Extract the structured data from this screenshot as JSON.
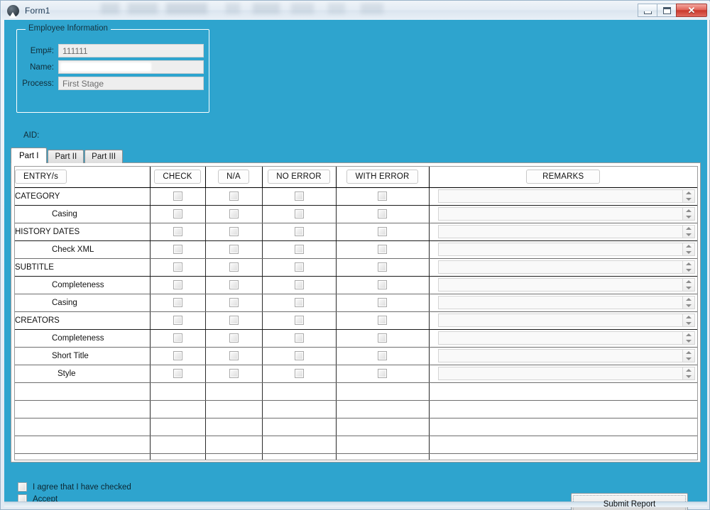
{
  "window": {
    "title": "Form1",
    "icon": "app-logo-icon",
    "buttons": {
      "minimize": "minimize-button",
      "maximize": "maximize-button",
      "close_label": "✕"
    }
  },
  "employee_group": {
    "legend": "Employee Information",
    "fields": [
      {
        "label": "Emp#:",
        "value": "111111",
        "redacted": false
      },
      {
        "label": "Name:",
        "value": "",
        "redacted": true
      },
      {
        "label": "Process:",
        "value": "First Stage",
        "redacted": false
      }
    ]
  },
  "aid": {
    "label": "AID:",
    "value": ""
  },
  "tabs": [
    {
      "label": "Part I",
      "active": true
    },
    {
      "label": "Part II",
      "active": false
    },
    {
      "label": "Part III",
      "active": false
    }
  ],
  "grid": {
    "headers": {
      "entry": "ENTRY/s",
      "check": "CHECK",
      "na": "N/A",
      "no_error": "NO ERROR",
      "with_error": "WITH ERROR",
      "remarks": "REMARKS"
    },
    "rows": [
      {
        "entry": "CATEGORY",
        "indent": 0,
        "major": true,
        "checkboxes": true,
        "remarks": "",
        "has_remarks": true
      },
      {
        "entry": "Casing",
        "indent": 1,
        "major": false,
        "checkboxes": true,
        "remarks": "",
        "has_remarks": true
      },
      {
        "entry": "HISTORY DATES",
        "indent": 0,
        "major": true,
        "checkboxes": true,
        "remarks": "",
        "has_remarks": true
      },
      {
        "entry": "Check XML",
        "indent": 1,
        "major": false,
        "checkboxes": true,
        "remarks": "",
        "has_remarks": true
      },
      {
        "entry": "SUBTITLE",
        "indent": 0,
        "major": true,
        "checkboxes": true,
        "remarks": "",
        "has_remarks": true
      },
      {
        "entry": "Completeness",
        "indent": 1,
        "major": false,
        "checkboxes": true,
        "remarks": "",
        "has_remarks": true
      },
      {
        "entry": "Casing",
        "indent": 1,
        "major": false,
        "checkboxes": true,
        "remarks": "",
        "has_remarks": true
      },
      {
        "entry": "CREATORS",
        "indent": 0,
        "major": true,
        "checkboxes": true,
        "remarks": "",
        "has_remarks": true
      },
      {
        "entry": "Completeness",
        "indent": 1,
        "major": false,
        "checkboxes": true,
        "remarks": "",
        "has_remarks": true
      },
      {
        "entry": "Short Title",
        "indent": 1,
        "major": false,
        "checkboxes": true,
        "remarks": "",
        "has_remarks": true
      },
      {
        "entry": "Style",
        "indent": 2,
        "major": false,
        "checkboxes": true,
        "remarks": "",
        "has_remarks": true
      },
      {
        "entry": "",
        "indent": 0,
        "major": false,
        "checkboxes": false,
        "remarks": "",
        "has_remarks": false
      },
      {
        "entry": "",
        "indent": 0,
        "major": false,
        "checkboxes": false,
        "remarks": "",
        "has_remarks": false
      },
      {
        "entry": "",
        "indent": 0,
        "major": false,
        "checkboxes": false,
        "remarks": "",
        "has_remarks": false
      },
      {
        "entry": "",
        "indent": 0,
        "major": false,
        "checkboxes": false,
        "remarks": "",
        "has_remarks": false
      },
      {
        "entry": "",
        "indent": 0,
        "major": false,
        "checkboxes": false,
        "remarks": "",
        "has_remarks": false
      }
    ]
  },
  "footer": {
    "checkboxes": [
      {
        "label": "I agree that I have checked",
        "checked": false
      },
      {
        "label": "Accept",
        "checked": false
      }
    ],
    "submit_label": "Submit Report"
  },
  "colors": {
    "form_background": "#2ea4ce",
    "grid_background": "#ffffff",
    "title_text": "#1e3a55",
    "close_button": "#c9382c"
  }
}
